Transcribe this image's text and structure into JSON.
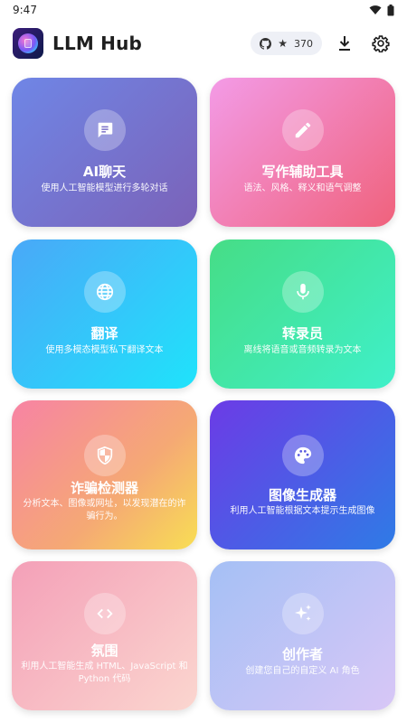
{
  "status_bar": {
    "time": "9:47"
  },
  "app_bar": {
    "title": "LLM Hub",
    "star_count": "370"
  },
  "cards": [
    {
      "title": "AI聊天",
      "desc": "使用人工智能模型进行多轮对话",
      "icon": "chat-icon"
    },
    {
      "title": "写作辅助工具",
      "desc": "语法、风格、释义和语气调整",
      "icon": "pencil-icon"
    },
    {
      "title": "翻译",
      "desc": "使用多模态模型私下翻译文本",
      "icon": "globe-icon"
    },
    {
      "title": "转录员",
      "desc": "离线将语音或音频转录为文本",
      "icon": "microphone-icon"
    },
    {
      "title": "诈骗检测器",
      "desc": "分析文本、图像或网址，以发现潜在的诈骗行为。",
      "icon": "shield-icon"
    },
    {
      "title": "图像生成器",
      "desc": "利用人工智能根据文本提示生成图像",
      "icon": "palette-icon"
    },
    {
      "title": "氛围",
      "desc": "利用人工智能生成 HTML、JavaScript 和 Python 代码",
      "icon": "code-icon"
    },
    {
      "title": "创作者",
      "desc": "创建您自己的自定义 AI 角色",
      "icon": "sparkles-icon"
    }
  ]
}
